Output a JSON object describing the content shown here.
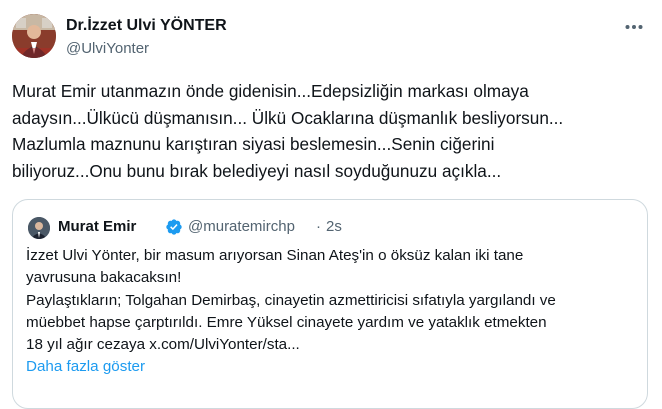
{
  "tweet": {
    "author_name": "Dr.İzzet Ulvi YÖNTER",
    "author_handle": "@UlviYonter",
    "more_icon": "more-horizontal-icon",
    "text": "Murat Emir utanmazın önde gidenisin...Edepsizliğin markası olmaya\nadaysın...Ülkücü düşmanısın... Ülkü Ocaklarına düşmanlık besliyorsun...\nMazlumla maznunu karıştıran siyasi beslemesin...Senin ciğerini\nbiliyoruz...Onu bunu bırak belediyeyi nasıl soyduğunuzu açıkla..."
  },
  "quote": {
    "author_name": "Murat Emir",
    "verified_icon": "verified-badge-icon",
    "author_handle": "@muratemirchp",
    "separator": "·",
    "time": "2s",
    "text": "İzzet Ulvi Yönter, bir masum arıyorsan Sinan Ateş'in o öksüz kalan iki tane\nyavrusuna bakacaksın!\nPaylaştıkların; Tolgahan Demirbaş, cinayetin azmettiricisi sıfatıyla yargılandı ve\nmüebbet hapse çarptırıldı. Emre Yüksel cinayete yardım ve yataklık etmekten\n18 yıl ağır cezaya  x.com/UlviYonter/sta...",
    "show_more_label": "Daha fazla göster"
  },
  "colors": {
    "text": "#0f1419",
    "secondary": "#536471",
    "link": "#1d9bf0",
    "border": "#cfd9de",
    "verified": "#1d9bf0"
  }
}
